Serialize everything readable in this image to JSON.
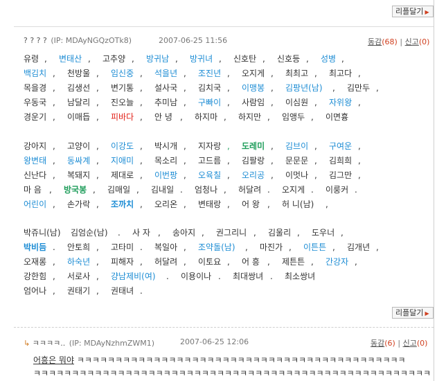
{
  "reply_button_label": "리플달기",
  "comment1": {
    "author": "? ? ? ?",
    "ip": "(IP: MDAyNGQzOTk8)",
    "date": "2007-06-25 11:56",
    "agree_label": "동감",
    "agree_count": "(68)",
    "separator": "|",
    "report_label": "신고",
    "report_count": "(0)",
    "lines": [
      [
        [
          "유령",
          ""
        ],
        [
          ",",
          ""
        ],
        [
          "변태산",
          "blue"
        ],
        [
          ",",
          ""
        ],
        [
          "고추양",
          ""
        ],
        [
          ",",
          ""
        ],
        [
          "방귀남",
          "blue"
        ],
        [
          ",",
          ""
        ],
        [
          "방귀녀",
          "blue"
        ],
        [
          ",",
          ""
        ],
        [
          "신호탄",
          ""
        ],
        [
          ",",
          ""
        ],
        [
          "신호등",
          ""
        ],
        [
          ",",
          ""
        ],
        [
          "성병",
          "blue"
        ],
        [
          ",",
          ""
        ]
      ],
      [
        [
          "백김치",
          "blue"
        ],
        [
          ",",
          ""
        ],
        [
          "천방울",
          ""
        ],
        [
          ",",
          ""
        ],
        [
          "임신중",
          "blue"
        ],
        [
          ",",
          ""
        ],
        [
          "석을년",
          "blue"
        ],
        [
          ",",
          ""
        ],
        [
          "조진년",
          "blue"
        ],
        [
          ",",
          ""
        ],
        [
          "오지게",
          ""
        ],
        [
          ",",
          ""
        ],
        [
          "최최고",
          ""
        ],
        [
          ",",
          ""
        ],
        [
          "최고다",
          ""
        ],
        [
          ",",
          ""
        ]
      ],
      [
        [
          "목을경",
          ""
        ],
        [
          ",",
          ""
        ],
        [
          "김생선",
          ""
        ],
        [
          ",",
          ""
        ],
        [
          "변기통",
          ""
        ],
        [
          ",",
          ""
        ],
        [
          "설사국",
          ""
        ],
        [
          ",",
          ""
        ],
        [
          "김치국",
          ""
        ],
        [
          ",",
          ""
        ],
        [
          "이맹봉",
          "blue"
        ],
        [
          ",",
          ""
        ],
        [
          "김팡년(남)",
          "blue"
        ],
        [
          ",",
          ""
        ],
        [
          "김만두",
          ""
        ],
        [
          ",",
          ""
        ]
      ],
      [
        [
          "우동국",
          ""
        ],
        [
          ",",
          ""
        ],
        [
          "남달리",
          ""
        ],
        [
          ",",
          ""
        ],
        [
          "진오늘",
          ""
        ],
        [
          ",",
          ""
        ],
        [
          "추미남",
          ""
        ],
        [
          ",",
          ""
        ],
        [
          "구빠이",
          "blue"
        ],
        [
          ",",
          ""
        ],
        [
          "사람임",
          ""
        ],
        [
          ",",
          ""
        ],
        [
          "이심원",
          ""
        ],
        [
          ",",
          ""
        ],
        [
          "자위왕",
          "blue"
        ],
        [
          ",",
          ""
        ]
      ],
      [
        [
          "경운기",
          ""
        ],
        [
          ",",
          ""
        ],
        [
          "이매듭",
          ""
        ],
        [
          ",",
          ""
        ],
        [
          "피바다",
          "red"
        ],
        [
          ",",
          ""
        ],
        [
          "안 녕",
          ""
        ],
        [
          ",",
          ""
        ],
        [
          "하지마",
          ""
        ],
        [
          ",",
          ""
        ],
        [
          "하지만",
          ""
        ],
        [
          ",",
          ""
        ],
        [
          "임앵두",
          ""
        ],
        [
          ",",
          ""
        ],
        [
          "이면흉",
          ""
        ]
      ]
    ],
    "lines2": [
      [
        [
          "강아지",
          ""
        ],
        [
          ",",
          ""
        ],
        [
          "고양이",
          ""
        ],
        [
          ",",
          ""
        ],
        [
          "이강도",
          "blue"
        ],
        [
          ",",
          ""
        ],
        [
          "박시개",
          ""
        ],
        [
          ",",
          ""
        ],
        [
          "지자랑",
          ""
        ],
        [
          ",",
          "green"
        ],
        [
          "도레미",
          "green"
        ],
        [
          ",",
          ""
        ],
        [
          "김브이",
          "blue"
        ],
        [
          ",",
          ""
        ],
        [
          "구여운",
          "blue"
        ],
        [
          ",",
          ""
        ]
      ],
      [
        [
          "왕변태",
          "blue"
        ],
        [
          ",",
          ""
        ],
        [
          "동싸계",
          "blue"
        ],
        [
          ",",
          ""
        ],
        [
          "지애미",
          "blue"
        ],
        [
          ",",
          ""
        ],
        [
          "목소리",
          ""
        ],
        [
          ",",
          ""
        ],
        [
          "고드름",
          ""
        ],
        [
          ",",
          ""
        ],
        [
          "김팔랑",
          ""
        ],
        [
          ",",
          ""
        ],
        [
          "문문문",
          ""
        ],
        [
          ",",
          ""
        ],
        [
          "김희희",
          ""
        ],
        [
          ",",
          ""
        ]
      ],
      [
        [
          "신난다",
          ""
        ],
        [
          ",",
          ""
        ],
        [
          "복돼지",
          ""
        ],
        [
          ",",
          ""
        ],
        [
          "제대로",
          ""
        ],
        [
          ",",
          ""
        ],
        [
          "이번팡",
          "blue"
        ],
        [
          ",",
          ""
        ],
        [
          "오육칠",
          "blue"
        ],
        [
          ",",
          ""
        ],
        [
          "오리공",
          "blue"
        ],
        [
          ",",
          ""
        ],
        [
          "이멋나",
          ""
        ],
        [
          ",",
          ""
        ],
        [
          "김그만",
          ""
        ],
        [
          ",",
          ""
        ]
      ],
      [
        [
          "마 음",
          ""
        ],
        [
          ",",
          ""
        ],
        [
          "방국봉",
          "green"
        ],
        [
          ",",
          ""
        ],
        [
          "김매일",
          ""
        ],
        [
          ",",
          ""
        ],
        [
          "김내일",
          ""
        ],
        [
          ".",
          ""
        ],
        [
          "엄청나",
          ""
        ],
        [
          ",",
          ""
        ],
        [
          "허달려",
          ""
        ],
        [
          ".",
          ""
        ],
        [
          "오지게",
          ""
        ],
        [
          ".",
          ""
        ],
        [
          "이룽커",
          ""
        ],
        [
          ".",
          ""
        ]
      ],
      [
        [
          "어린이",
          "blue"
        ],
        [
          ",",
          ""
        ],
        [
          "손가락",
          ""
        ],
        [
          ",",
          ""
        ],
        [
          "조까치",
          "blue"
        ],
        [
          ",",
          ""
        ],
        [
          "오리온",
          ""
        ],
        [
          ",",
          ""
        ],
        [
          "변태랑",
          ""
        ],
        [
          ",",
          ""
        ],
        [
          "어 왕",
          ""
        ],
        [
          ",",
          ""
        ],
        [
          "허 니(남)",
          ""
        ],
        [
          ",",
          ""
        ]
      ]
    ],
    "lines3": [
      [
        [
          "박쥬니(남)",
          ""
        ],
        [
          "김엄순(남)",
          ""
        ],
        [
          ".",
          ""
        ],
        [
          "사 자",
          ""
        ],
        [
          ",",
          ""
        ],
        [
          "송아지",
          ""
        ],
        [
          ",",
          ""
        ],
        [
          "권그리니",
          ""
        ],
        [
          ",",
          ""
        ],
        [
          "김울리",
          ""
        ],
        [
          ",",
          ""
        ],
        [
          "도우너",
          ""
        ],
        [
          ",",
          ""
        ]
      ],
      [
        [
          "박비듬",
          "blue"
        ],
        [
          ".",
          ""
        ],
        [
          "안토희",
          ""
        ],
        [
          ",",
          ""
        ],
        [
          "고타미",
          ""
        ],
        [
          ".",
          ""
        ],
        [
          "복일아",
          ""
        ],
        [
          ",",
          ""
        ],
        [
          "조약돌(남)",
          "blue"
        ],
        [
          ",",
          ""
        ],
        [
          "마진가",
          ""
        ],
        [
          ",",
          ""
        ],
        [
          "이튼튼",
          "blue"
        ],
        [
          ",",
          ""
        ],
        [
          "김개년",
          ""
        ],
        [
          ",",
          ""
        ]
      ],
      [
        [
          "오재롱",
          ""
        ],
        [
          ",",
          ""
        ],
        [
          "하숙년",
          "blue"
        ],
        [
          ",",
          ""
        ],
        [
          "피해자",
          ""
        ],
        [
          ",",
          ""
        ],
        [
          "허달려",
          ""
        ],
        [
          ",",
          ""
        ],
        [
          "이토요",
          ""
        ],
        [
          ",",
          ""
        ],
        [
          "어 흥",
          ""
        ],
        [
          ",",
          ""
        ],
        [
          "제튼튼",
          ""
        ],
        [
          ",",
          ""
        ],
        [
          "간강자",
          "blue"
        ],
        [
          ",",
          ""
        ]
      ],
      [
        [
          "강한힘",
          ""
        ],
        [
          ",",
          ""
        ],
        [
          "서로사",
          ""
        ],
        [
          ",",
          ""
        ],
        [
          "걍남제비(여)",
          "blue"
        ],
        [
          ".",
          ""
        ],
        [
          "이용이나",
          ""
        ],
        [
          ".",
          ""
        ],
        [
          "최대쌍녀",
          ""
        ],
        [
          ".",
          ""
        ],
        [
          "최소쌍녀",
          ""
        ]
      ],
      [
        [
          "엄어나",
          ""
        ],
        [
          ",",
          ""
        ],
        [
          "권태기",
          ""
        ],
        [
          ",",
          ""
        ],
        [
          "권태녀",
          ""
        ],
        [
          ".",
          ""
        ]
      ]
    ]
  },
  "comment2": {
    "author": "ㅋㅋㅋㅋ..",
    "ip": "(IP: MDAyNzhmZWM1)",
    "date": "2007-06-25 12:06",
    "agree_label": "동감",
    "agree_count": "(6)",
    "separator": "|",
    "report_label": "신고",
    "report_count": "(0)",
    "text_line1_prefix": "어흥은 뭐야",
    "text_line1_rest": "ㅋㅋㅋㅋㅋㅋㅋㅋㅋㅋㅋㅋㅋㅋㅋㅋㅋㅋㅋㅋㅋㅋㅋㅋㅋㅋㅋㅋㅋㅋㅋㅋㅋㅋㅋㅋㅋㅋㅋㅋㅋㅋㅋ",
    "text_line2": "ㅋㅋㅋㅋㅋㅋㅋㅋㅋㅋㅋㅋㅋㅋㅋㅋㅋㅋㅋㅋㅋㅋㅋㅋㅋㅋㅋㅋㅋㅋㅋㅋㅋㅋㅋㅋㅋㅋㅋㅋㅋㅋㅋㅋㅋㅋㅋㅋㅋㅋㅋㅋ"
  }
}
